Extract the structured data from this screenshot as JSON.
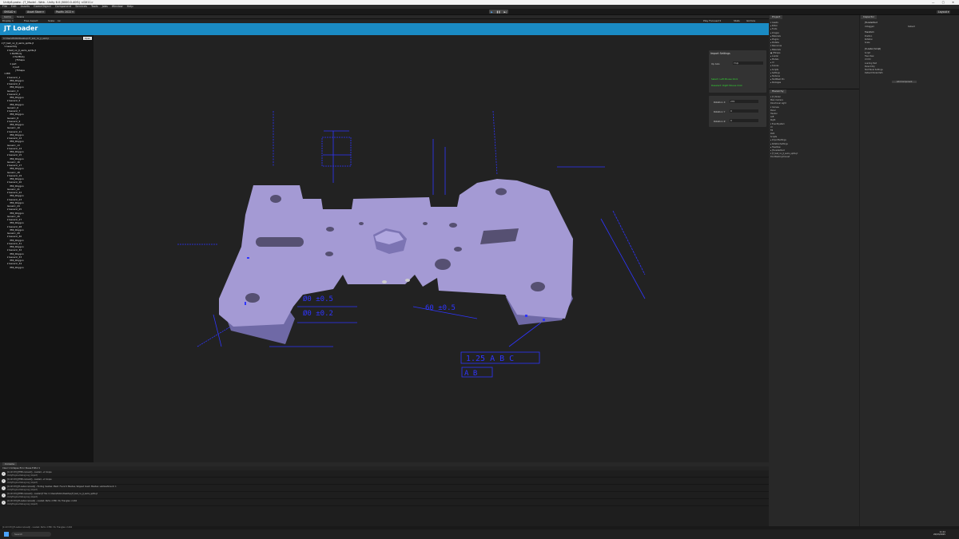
{
  "window": {
    "title": "Unity6.proto - JT_Model - Web - Unity 6.0 (6000.0.40f1) <DX11>"
  },
  "menu": [
    "File",
    "Edit",
    "Assets",
    "GameObject",
    "Component",
    "Services",
    "Tools",
    "Jobs",
    "Window",
    "Help"
  ],
  "toolbar": {
    "account": "SMSAD ▾",
    "asset_store": "Asset Store ▾",
    "version": "Pacific 2022 ▾",
    "layout": "Layout ▾"
  },
  "game_tabs": {
    "game": "Game",
    "scene": "Scene",
    "display": "Display 1",
    "aspect": "Free Aspect",
    "scale_label": "Scale",
    "scale_value": "1x",
    "play_focused": "Play Focused ▾",
    "stats": "Stats",
    "gizmos": "Gizmos"
  },
  "jt_loader": {
    "title": "JT Loader",
    "path_placeholder": "",
    "path_value": "C:/Users/Public/Desktop/JT_test_nx_jt_ascii.jt",
    "open_label": "Open",
    "tree": [
      {
        "indent": 0,
        "text": "▾ JT_test_nx_jt_asms_splits.jt"
      },
      {
        "indent": 1,
        "text": "▾ Assembly"
      },
      {
        "indent": 2,
        "text": "▾ test_nx_jt_asms_splits.jt"
      },
      {
        "indent": 3,
        "text": "▾ PartBody"
      },
      {
        "indent": 4,
        "text": "▾ PartBody"
      },
      {
        "indent": 5,
        "text": "JTShape"
      },
      {
        "indent": 3,
        "text": "▾ part"
      },
      {
        "indent": 4,
        "text": "▾ part"
      },
      {
        "indent": 5,
        "text": "JTShape"
      },
      {
        "indent": 1,
        "text": "▾ PMI"
      },
      {
        "indent": 2,
        "text": "▾ Generic_1"
      },
      {
        "indent": 3,
        "text": "PMI_Polygon"
      },
      {
        "indent": 2,
        "text": "▾ Generic_2"
      },
      {
        "indent": 3,
        "text": "PMI_Polygon"
      },
      {
        "indent": 2,
        "text": "Generic_3"
      },
      {
        "indent": 2,
        "text": "▾ Generic_4"
      },
      {
        "indent": 3,
        "text": "PMI_Polygon"
      },
      {
        "indent": 2,
        "text": "▾ Generic_5"
      },
      {
        "indent": 3,
        "text": "PMI_Polygon"
      },
      {
        "indent": 2,
        "text": "Generic_6"
      },
      {
        "indent": 2,
        "text": "▾ Generic_7"
      },
      {
        "indent": 3,
        "text": "PMI_Polygon"
      },
      {
        "indent": 2,
        "text": "Generic_8"
      },
      {
        "indent": 2,
        "text": "▾ Generic_9"
      },
      {
        "indent": 3,
        "text": "PMI_Polygon"
      },
      {
        "indent": 2,
        "text": "Generic_10"
      },
      {
        "indent": 2,
        "text": "▾ Generic_11"
      },
      {
        "indent": 3,
        "text": "PMI_Polygon"
      },
      {
        "indent": 2,
        "text": "▾ Generic_12"
      },
      {
        "indent": 3,
        "text": "PMI_Polygon"
      },
      {
        "indent": 2,
        "text": "Generic_13"
      },
      {
        "indent": 2,
        "text": "▾ Generic_14"
      },
      {
        "indent": 3,
        "text": "PMI_Polygon"
      },
      {
        "indent": 2,
        "text": "▾ Generic_15"
      },
      {
        "indent": 3,
        "text": "PMI_Polygon"
      },
      {
        "indent": 2,
        "text": "Generic_16"
      },
      {
        "indent": 2,
        "text": "▾ Generic_17"
      },
      {
        "indent": 3,
        "text": "PMI_Polygon"
      },
      {
        "indent": 2,
        "text": "Generic_18"
      },
      {
        "indent": 2,
        "text": "▾ Generic_19"
      },
      {
        "indent": 3,
        "text": "PMI_Polygon"
      },
      {
        "indent": 2,
        "text": "▾ Generic_20"
      },
      {
        "indent": 3,
        "text": "PMI_Polygon"
      },
      {
        "indent": 2,
        "text": "Generic_21"
      },
      {
        "indent": 2,
        "text": "▾ Generic_22"
      },
      {
        "indent": 3,
        "text": "PMI_Polygon"
      },
      {
        "indent": 2,
        "text": "▾ Generic_23"
      },
      {
        "indent": 3,
        "text": "PMI_Polygon"
      },
      {
        "indent": 2,
        "text": "Generic_24"
      },
      {
        "indent": 2,
        "text": "▾ Generic_25"
      },
      {
        "indent": 3,
        "text": "PMI_Polygon"
      },
      {
        "indent": 2,
        "text": "Generic_26"
      },
      {
        "indent": 2,
        "text": "▾ Generic_27"
      },
      {
        "indent": 3,
        "text": "PMI_Polygon"
      },
      {
        "indent": 2,
        "text": "▾ Generic_28"
      },
      {
        "indent": 3,
        "text": "PMI_Polygon"
      },
      {
        "indent": 2,
        "text": "Generic_29"
      },
      {
        "indent": 2,
        "text": "▾ Generic_30"
      },
      {
        "indent": 3,
        "text": "PMI_Polygon"
      },
      {
        "indent": 2,
        "text": "▾ Generic_31"
      },
      {
        "indent": 3,
        "text": "PMI_Polygon"
      },
      {
        "indent": 2,
        "text": "▾ Generic_32"
      },
      {
        "indent": 3,
        "text": "PMI_Polygon"
      },
      {
        "indent": 2,
        "text": "▾ Generic_33"
      },
      {
        "indent": 3,
        "text": "PMI_Polygon"
      },
      {
        "indent": 2,
        "text": "▾ Generic_34"
      },
      {
        "indent": 3,
        "text": "PMI_Polygon"
      }
    ],
    "import_settings": {
      "title": "Import Settings",
      "up_axis_label": "Up Axis",
      "up_axis_value": "Y-Up",
      "hint1": "Select: Left Mouse Click",
      "hint2": "Deselect: Right Mouse Click"
    },
    "rotation": {
      "x_label": "Rotation X",
      "x_value": "270",
      "y_label": "Rotation Y",
      "y_value": "0",
      "z_label": "Rotation Z",
      "z_value": "0"
    },
    "pmi_labels": [
      "1.25 A B C",
      "Ø0 ±0.5",
      "Ø0 ±0.2",
      "60 ±0.5"
    ]
  },
  "console": {
    "tab": "Console",
    "bar": "Clear ▾  Collapse  Error Pause  Editor ▾",
    "logs": [
      {
        "l1": "[11:23:33] JTPMI.cs/Load() - Loaded, +1 Scope",
        "l2": "UnityEngine.Debug:Log (object)"
      },
      {
        "l1": "[11:23:33] JTPMI.cs/Load() - Loaded, +1 Scope",
        "l2": "UnityEngine.Debug:Log (object)"
      },
      {
        "l1": "[11:23:33] JTLoader.cs/Load() - Finding meshes: Mesh: Found 2 Meshes, Skipped mesh: Meshes: submeshCount: 1",
        "l2": "UnityEngine.Debug:Log (object)"
      },
      {
        "l1": "[11:23:33] JTPMI.cs/Load() - Loaded JT file: C:/Users/Public/Desktop/JT_test_nx_jt_asms_splits.jt",
        "l2": "UnityEngine.Debug:Log (object)"
      },
      {
        "l1": "[11:23:33] JTLoader.cs/Load() - Loaded. Parts: 2 PMI: 34, Triangles: 2,204",
        "l2": "UnityEngine.Debug:Log (object)"
      }
    ]
  },
  "statusbar": "[11:23:33] JTLoader.cs/Load() - Loaded. Parts: 2 PMI: 34, Triangles: 2,204",
  "project": {
    "tab": "Project",
    "items": [
      "▾ Assets",
      "  ▸ Editor",
      "  ▸ Fonts",
      "  ▸ Images",
      "  ▸ Materials",
      "  ▸ Plugins",
      "  ▸ Prefabs",
      "  ▾ Resources",
      "    ▸ Materials",
      "    ● JTShape",
      "    ▸ Loader",
      "    ▸ Models",
      "    ▸ UI",
      "  ▸ Scenes",
      "  ▸ Scripts",
      "  ▸ Settings",
      "  ▸ Textures",
      "  ▸ TextMesh Pro",
      "  ▸ Packages"
    ]
  },
  "hierarchy": {
    "tab": "Hierarchy",
    "items": [
      "▾ JT_Model",
      "   Main Camera",
      "   Directional Light",
      "  ▾ Canvas",
      "     Panel",
      "     Header",
      "     Left",
      "     Right",
      "  ▾ EventSystem",
      "     UI",
      "     Fill",
      "     Path",
      "   Scripts",
      "  ▸ ImportSettings",
      "  ▸ RotationSettings",
      "  ▸ TreeView",
      "  ▸ JTLoaderRoot",
      "  ▾ JT_test_nx_jt_asms_splits.jt",
      "   DontDestroyOnLoad"
    ]
  },
  "inspector": {
    "tab": "Inspector",
    "object": "JTLoaderRoot",
    "tag": "Untagged",
    "layer": "Default",
    "transform": "Transform",
    "rows": [
      "Position",
      "Rotation",
      "Scale"
    ],
    "component": "Jt Loader (Script)",
    "fields": [
      "Script",
      "Tree View",
      "UI Ctrl",
      "Loading Text",
      "Parent Obj",
      "Text Panel Settings",
      "Default Model Path"
    ],
    "add_component": "Add Component"
  },
  "taskbar": {
    "search": "Search",
    "time": "11:24",
    "date": "20/03/2025"
  },
  "colors": {
    "header_blue": "#1a8bc4",
    "model_lavender": "#a49ad4",
    "pmi_blue": "#2f35ff",
    "hint_green": "#33dd33"
  }
}
